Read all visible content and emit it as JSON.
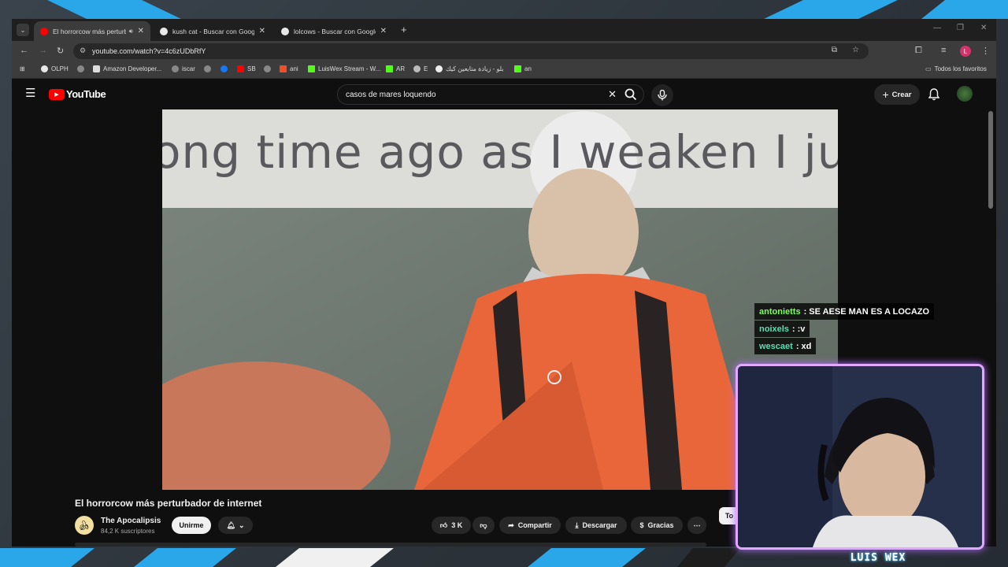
{
  "browser": {
    "tabs": [
      {
        "title": "El horrorcow más perturbador de internet",
        "favicon_color": "#ff0000",
        "active": true
      },
      {
        "title": "kush cat - Buscar con Google",
        "favicon_color": "#dddddd",
        "active": false
      },
      {
        "title": "lolcows - Buscar con Google",
        "favicon_color": "#dddddd",
        "active": false
      }
    ],
    "url": "youtube.com/watch?v=4c6zUDbRfY",
    "profile_initial": "L",
    "bookmarks": [
      {
        "label": "OLPH",
        "icon": "google-icon"
      },
      {
        "label": "",
        "icon": "globe-icon"
      },
      {
        "label": "Amazon Developer...",
        "icon": "amazon-icon"
      },
      {
        "label": "iscar",
        "icon": "globe-icon"
      },
      {
        "label": "",
        "icon": "globe-icon"
      },
      {
        "label": "",
        "icon": "facebook-icon"
      },
      {
        "label": "SB",
        "icon": "youtube-icon"
      },
      {
        "label": "",
        "icon": "globe-icon"
      },
      {
        "label": "ani",
        "icon": "windows-icon"
      },
      {
        "label": "LuisWex Stream - W...",
        "icon": "kick-icon"
      },
      {
        "label": "AR",
        "icon": "kick-icon"
      },
      {
        "label": "E",
        "icon": "openai-icon"
      },
      {
        "label": "بلو - زيادة متابعين كيك",
        "icon": "circle-icon"
      },
      {
        "label": "an",
        "icon": "kick-icon"
      }
    ],
    "all_bookmarks_label": "Todos los favoritos"
  },
  "youtube": {
    "logo_text": "YouTube",
    "search_query": "casos de mares loquendo",
    "create_label": "Crear",
    "video": {
      "caption_text": "ong time ago as I weaken I ju",
      "title": "El horrorcow más perturbador de internet",
      "channel_name": "The Apocalipsis",
      "subscribers": "84,2 K suscriptores",
      "join_label": "Unirme",
      "likes": "3 K",
      "share_label": "Compartir",
      "download_label": "Descargar",
      "thanks_label": "Gracias",
      "side_chip": "To"
    }
  },
  "stream": {
    "chat": [
      {
        "user": "antonietts",
        "text": ": SE AESE MAN ES A LOCAZO",
        "color": "#7dff5a"
      },
      {
        "user": "noixels",
        "text": ": :v",
        "color": "#54e0b4"
      },
      {
        "user": "wescaet",
        "text": ": xd",
        "color": "#54e0b4"
      }
    ],
    "streamer_name": "LUIS WEX",
    "accent_color": "#b46cff"
  }
}
